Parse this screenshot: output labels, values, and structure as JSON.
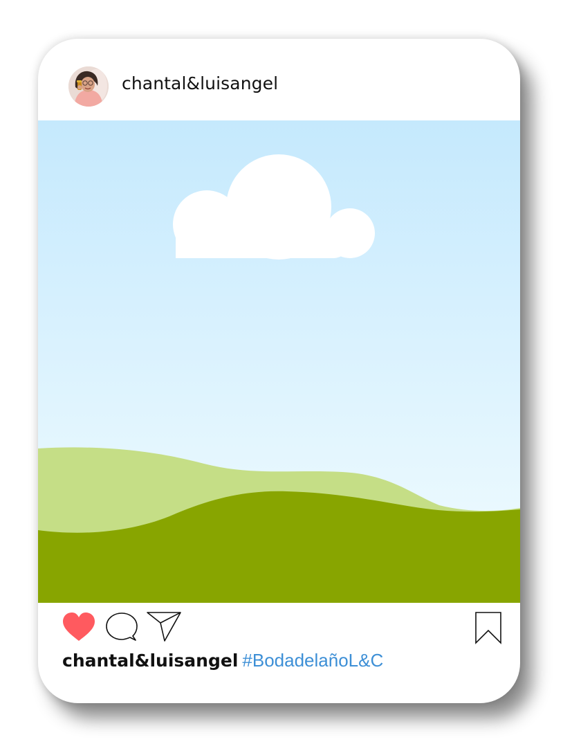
{
  "post": {
    "username": "chantal&luisangel",
    "caption_user": "chantal&luisangel",
    "caption_hashtag": "#BodadelañoL&C"
  },
  "icons": {
    "avatar": "profile-photo",
    "like": "heart-icon",
    "comment": "comment-bubble-icon",
    "share": "paper-plane-icon",
    "save": "bookmark-icon"
  },
  "colors": {
    "like_active": "#ff5a5f",
    "hashtag": "#3d8fd6",
    "sky_top": "#c5e9fd",
    "sky_bottom": "#f0fbff",
    "hill_light": "#c5de86",
    "hill_dark": "#88a500",
    "cloud": "#ffffff"
  },
  "state": {
    "liked": true
  }
}
